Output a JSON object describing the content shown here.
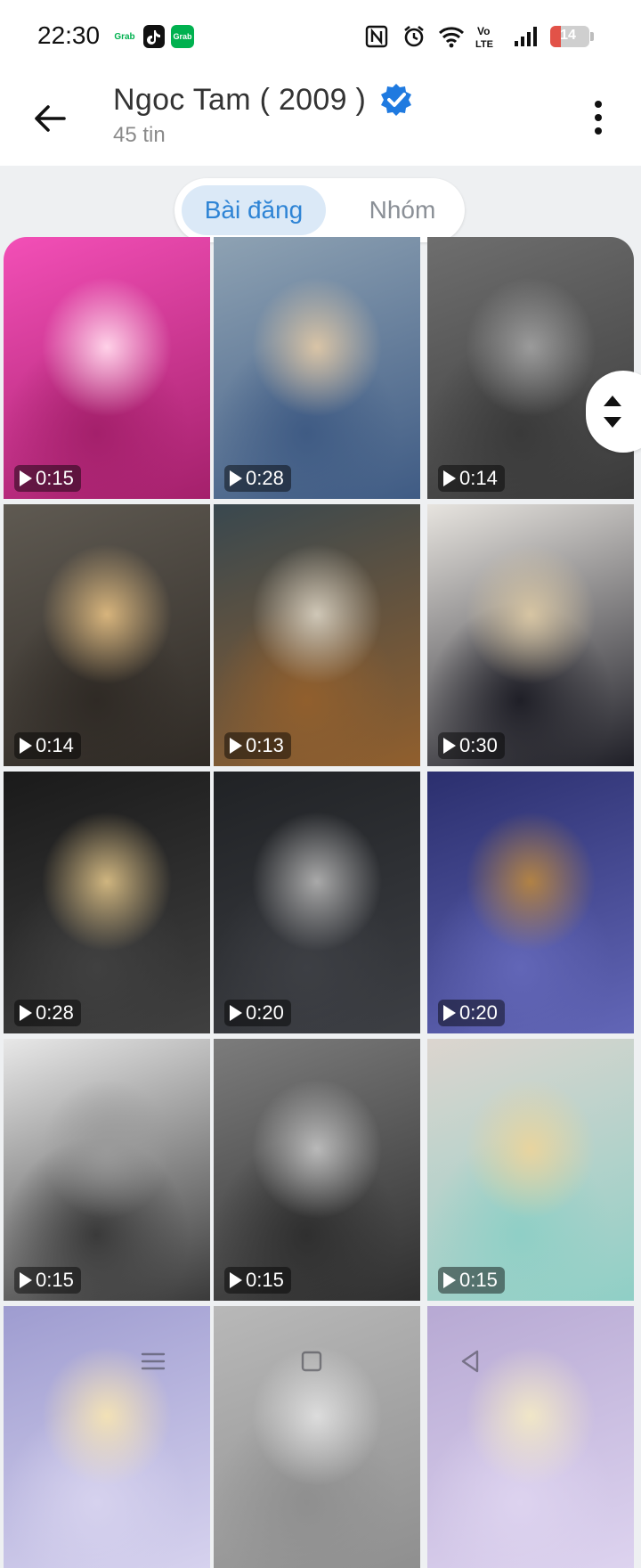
{
  "status_bar": {
    "time": "22:30",
    "apps": [
      "grab",
      "tiktok",
      "grab-food"
    ],
    "battery_level": "14",
    "colors": {
      "grab": "#00b14f",
      "tiktok": "#111111",
      "battery_low": "#e25248"
    }
  },
  "header": {
    "title": "Ngoc Tam ( 2009 )",
    "subtitle": "45 tin",
    "verified": true,
    "verified_color": "#1f7ae0"
  },
  "tabs": {
    "active": "Bài đăng",
    "items": [
      {
        "label": "Bài đăng"
      },
      {
        "label": "Nhóm"
      }
    ],
    "accent": "#2e84d5"
  },
  "media": [
    {
      "duration": "0:15",
      "palette": [
        "#f34fb7",
        "#a4206b",
        "#ffd1e8"
      ]
    },
    {
      "duration": "0:28",
      "palette": [
        "#8ea2b3",
        "#3f5b84",
        "#d9c4a6"
      ]
    },
    {
      "duration": "0:14",
      "palette": [
        "#6e6e6e",
        "#3a3a3a",
        "#9b9b9b"
      ]
    },
    {
      "duration": "0:14",
      "palette": [
        "#5f5a52",
        "#2f2a25",
        "#d7b47c"
      ]
    },
    {
      "duration": "0:13",
      "palette": [
        "#39484f",
        "#915f2d",
        "#cfc7b7"
      ]
    },
    {
      "duration": "0:30",
      "palette": [
        "#e7e4df",
        "#1f1f27",
        "#d7c5a3"
      ]
    },
    {
      "duration": "0:28",
      "palette": [
        "#1a1a1a",
        "#404040",
        "#cfb57f"
      ]
    },
    {
      "duration": "0:20",
      "palette": [
        "#202225",
        "#3d3f44",
        "#a9a9a9"
      ]
    },
    {
      "duration": "0:20",
      "palette": [
        "#2b2f6e",
        "#6266b7",
        "#b18245"
      ]
    },
    {
      "duration": "0:15",
      "palette": [
        "#e8e8e8",
        "#3a3a3a",
        "#9a9a9a"
      ]
    },
    {
      "duration": "0:15",
      "palette": [
        "#7c7c7c",
        "#2f2f2f",
        "#b9b9b9"
      ]
    },
    {
      "duration": "0:15",
      "palette": [
        "#dcd5cf",
        "#8fcfc6",
        "#e8d49f"
      ]
    },
    {
      "duration": "",
      "palette": [
        "#9e9cd0",
        "#d6d2ee",
        "#f2e1b6"
      ]
    },
    {
      "duration": "",
      "palette": [
        "#b8b8b8",
        "#8f8f8f",
        "#dcdcdc"
      ]
    },
    {
      "duration": "",
      "palette": [
        "#b7a9d3",
        "#ddd3ef",
        "#f0e6c7"
      ]
    }
  ],
  "icons": {
    "back": "arrow-left-icon",
    "menu": "more-vertical-icon",
    "scroll": "scroll-handle-icon",
    "nav": [
      "menu-nav-icon",
      "home-nav-icon",
      "back-nav-icon"
    ]
  }
}
